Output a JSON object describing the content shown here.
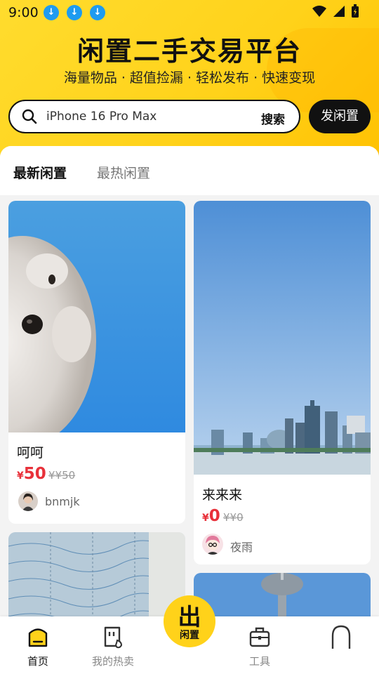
{
  "status_bar": {
    "time": "9:00"
  },
  "header": {
    "title": "闲置二手交易平台",
    "subtitle": "海量物品 · 超值捡漏 · 轻松发布 · 快速变现"
  },
  "search": {
    "value": "iPhone 16 Pro Max",
    "button": "搜索"
  },
  "post_button": "发闲置",
  "tabs": [
    {
      "label": "最新闲置",
      "active": true
    },
    {
      "label": "最热闲置",
      "active": false
    }
  ],
  "items": [
    {
      "title": "呵呵",
      "currency": "¥",
      "price": "50",
      "original": "¥¥50",
      "user": "bnmjk"
    },
    {
      "title": "来来来",
      "currency": "¥",
      "price": "0",
      "original": "¥¥0",
      "user": "夜雨"
    }
  ],
  "bottom_nav": {
    "home": "首页",
    "my_hot": "我的热卖",
    "center_top": "出",
    "center_bottom": "闲置",
    "tools": "工具"
  },
  "colors": {
    "accent": "#ffd21a",
    "price": "#e8313a",
    "download_badge": "#1e9bf0"
  }
}
